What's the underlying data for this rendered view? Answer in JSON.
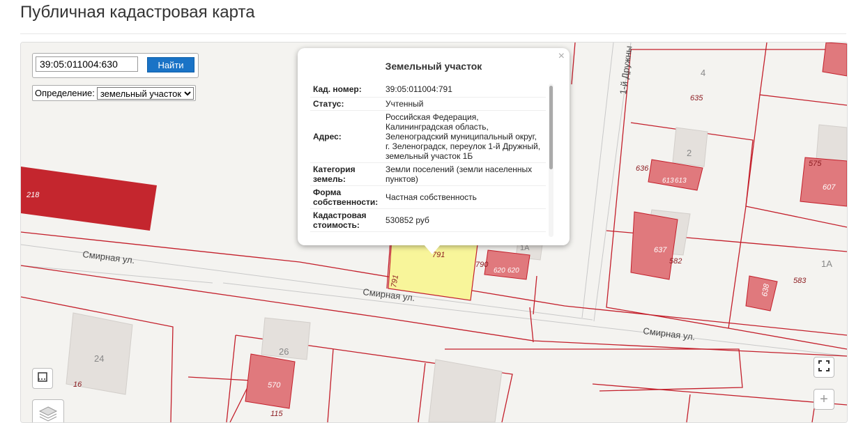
{
  "page": {
    "title": "Публичная кадастровая карта"
  },
  "search": {
    "value": "39:05:011004:630",
    "button_label": "Найти"
  },
  "definition": {
    "label": "Определение:",
    "selected": "земельный участок"
  },
  "popup": {
    "title": "Земельный участок",
    "close": "×",
    "rows": [
      {
        "key": "Кад. номер:",
        "value": "39:05:011004:791"
      },
      {
        "key": "Статус:",
        "value": "Учтенный"
      },
      {
        "key": "Адрес:",
        "value": "Российская Федерация, Калининградская область, Зеленоградский муниципальный округ, г. Зеленоградск, переулок 1-й Дружный, земельный участок 1Б"
      },
      {
        "key": "Категория земель:",
        "value": "Земли поселений (земли населенных пунктов)"
      },
      {
        "key": "Форма собственности:",
        "value": "Частная собственность"
      },
      {
        "key": "Кадастровая стоимость:",
        "value": "530852 руб"
      }
    ]
  },
  "map": {
    "streets": [
      "Смирная ул.",
      "Смирная ул.",
      "Смирная ул.",
      "1-й Дружны"
    ],
    "labels": [
      "218",
      "791",
      "791",
      "790",
      "620",
      "620",
      "1А",
      "4",
      "635",
      "2",
      "636",
      "613",
      "613",
      "637",
      "582",
      "575",
      "607",
      "1А",
      "638",
      "583",
      "24",
      "16",
      "26",
      "570",
      "115"
    ],
    "colors": {
      "parcel_red": "#c0262c",
      "building_pink": "#e0797d",
      "selected": "#f8f59a",
      "boundary": "#c31e2a"
    }
  }
}
